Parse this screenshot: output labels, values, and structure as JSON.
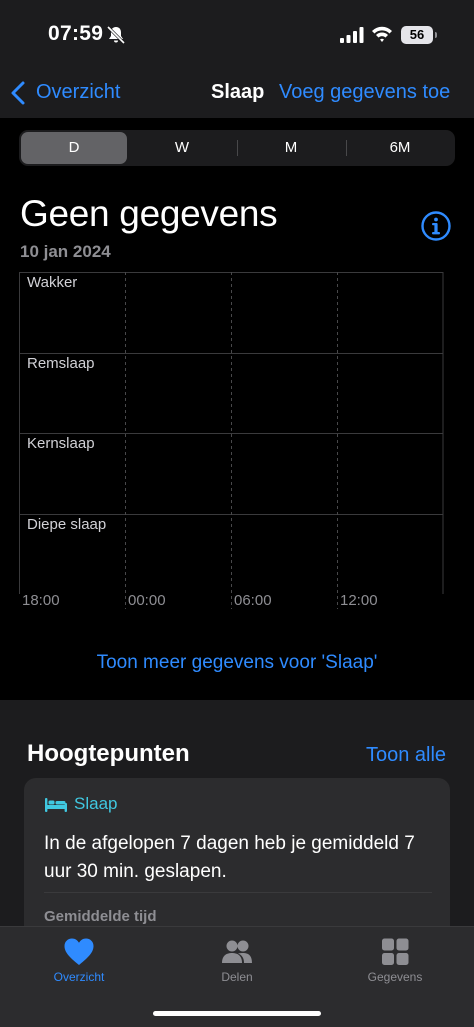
{
  "status_bar": {
    "time": "07:59",
    "battery": "56"
  },
  "nav": {
    "back_label": "Overzicht",
    "title": "Slaap",
    "action_label": "Voeg gegevens toe"
  },
  "segments": [
    {
      "label": "D",
      "active": true
    },
    {
      "label": "W",
      "active": false
    },
    {
      "label": "M",
      "active": false
    },
    {
      "label": "6M",
      "active": false
    }
  ],
  "header": {
    "headline": "Geen gegevens",
    "date": "10 jan 2024"
  },
  "chart_data": {
    "type": "bar",
    "categories": [
      "Wakker",
      "Remslaap",
      "Kernslaap",
      "Diepe slaap"
    ],
    "x_ticks": [
      "18:00",
      "00:00",
      "06:00",
      "12:00"
    ],
    "series": [],
    "grid": true
  },
  "more_link": "Toon meer gegevens voor 'Slaap'",
  "highlights": {
    "title": "Hoogtepunten",
    "show_all": "Toon alle",
    "card": {
      "category": "Slaap",
      "text": "In de afgelopen 7 dagen heb je gemiddeld 7 uur 30 min. geslapen.",
      "sub": "Gemiddelde tijd"
    }
  },
  "tabs": [
    {
      "label": "Overzicht",
      "icon": "heart-icon",
      "active": true
    },
    {
      "label": "Delen",
      "icon": "people-icon",
      "active": false
    },
    {
      "label": "Gegevens",
      "icon": "grid-icon",
      "active": false
    }
  ],
  "colors": {
    "accent": "#2f8bff",
    "sleep": "#40c8e0"
  }
}
